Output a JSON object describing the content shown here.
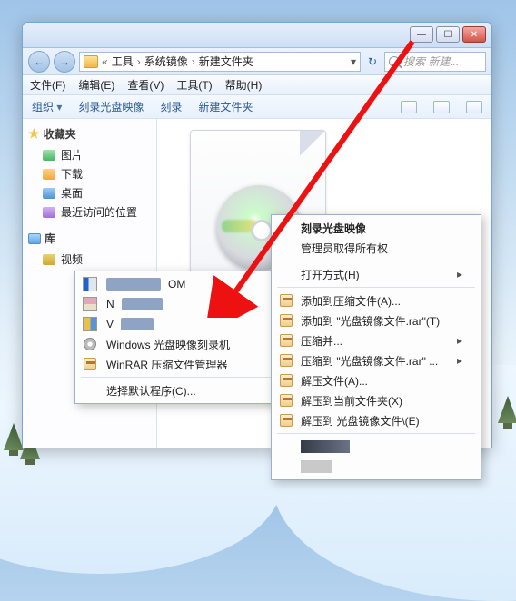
{
  "titlebar": {
    "min": "—",
    "max": "☐",
    "close": "✕"
  },
  "nav": {
    "back": "←",
    "fwd": "→",
    "crumb_prefix": "«",
    "crumb1": "工具",
    "crumb2": "系统镜像",
    "crumb3": "新建文件夹",
    "drop": "▾",
    "refresh": "↻",
    "search_placeholder": "搜索 新建..."
  },
  "menu": {
    "file": "文件(F)",
    "edit": "编辑(E)",
    "view": "查看(V)",
    "tools": "工具(T)",
    "help": "帮助(H)"
  },
  "toolbar": {
    "org": "组织",
    "burn": "刻录光盘映像",
    "burn2": "刻录",
    "newfolder": "新建文件夹"
  },
  "side": {
    "fav": "收藏夹",
    "pic": "图片",
    "dl": "下载",
    "desk": "桌面",
    "recent": "最近访问的位置",
    "lib": "库",
    "video": "视频"
  },
  "openwith": {
    "item1_suffix": "OM",
    "item2_prefix": "N",
    "item3_prefix": "V",
    "item4": "Windows 光盘映像刻录机",
    "item5": "WinRAR 压缩文件管理器",
    "choose": "选择默认程序(C)..."
  },
  "ctx": {
    "burn_bold": "刻录光盘映像",
    "admin": "管理员取得所有权",
    "openwith": "打开方式(H)",
    "add_archive": "添加到压缩文件(A)...",
    "add_named": "添加到 \"光盘镜像文件.rar\"(T)",
    "compress_and": "压缩并...",
    "compress_to": "压缩到 \"光盘镜像文件.rar\" ...",
    "extract": "解压文件(A)...",
    "extract_here": "解压到当前文件夹(X)",
    "extract_to": "解压到 光盘镜像文件\\(E)"
  }
}
